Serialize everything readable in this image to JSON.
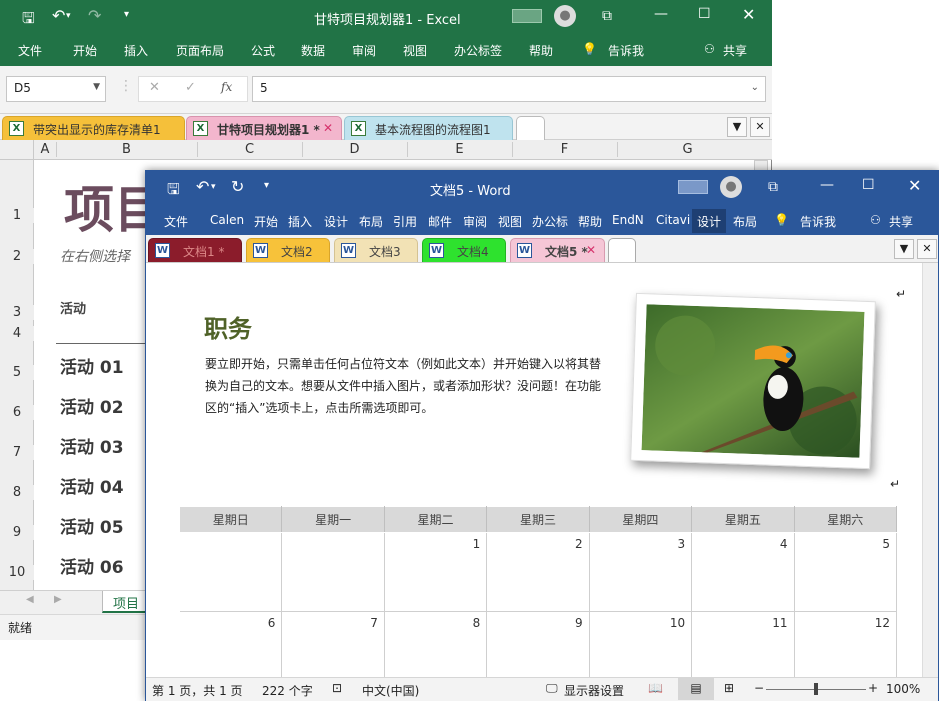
{
  "excel": {
    "title": "甘特项目规划器1  -  Excel",
    "menu": [
      "文件",
      "开始",
      "插入",
      "页面布局",
      "公式",
      "数据",
      "审阅",
      "视图",
      "办公标签",
      "帮助"
    ],
    "tell_me": "告诉我",
    "share": "共享",
    "name_box": "D5",
    "formula_value": "5",
    "fx_label": "fx",
    "doc_tabs": [
      {
        "label": "带突出显示的库存清单1",
        "color": "#f5c03a",
        "active": false
      },
      {
        "label": "甘特项目规划器1 *",
        "color": "#f3b6cd",
        "active": true
      },
      {
        "label": "基本流程图的流程图1",
        "color": "#bfe3ee",
        "active": false
      }
    ],
    "columns": [
      "A",
      "B",
      "C",
      "D",
      "E",
      "F",
      "G"
    ],
    "rows": [
      "1",
      "2",
      "3",
      "4",
      "5",
      "6",
      "7",
      "8",
      "9",
      "10"
    ],
    "sheet_title": "项目",
    "hint": "在右侧选择",
    "activity_header": "活动",
    "activities": [
      "活动 01",
      "活动 02",
      "活动 03",
      "活动 04",
      "活动 05",
      "活动 06"
    ],
    "sheet_tab": "项目规",
    "status": "就绪"
  },
  "word": {
    "title": "文档5  -  Word",
    "menu": [
      "文件",
      "Calen",
      "开始",
      "插入",
      "设计",
      "布局",
      "引用",
      "邮件",
      "审阅",
      "视图",
      "办公标",
      "帮助",
      "EndN",
      "Citavi",
      "设计",
      "布局"
    ],
    "tell_me": "告诉我",
    "share": "共享",
    "doc_tabs": [
      {
        "label": "文档1 *",
        "color": "#8b1c2b",
        "text_color": "#d88",
        "active": false
      },
      {
        "label": "文档2",
        "color": "#f7c23a",
        "text_color": "#333",
        "active": false
      },
      {
        "label": "文档3",
        "color": "#f2e2b5",
        "text_color": "#333",
        "active": false
      },
      {
        "label": "文档4",
        "color": "#2ee22e",
        "text_color": "#333",
        "active": false
      },
      {
        "label": "文档5 *",
        "color": "#f5c6d6",
        "text_color": "#333",
        "active": true
      }
    ],
    "heading": "职务",
    "body": "要立即开始，只需单击任何占位符文本（例如此文本）并开始键入以将其替换为自己的文本。想要从文件中插入图片，或者添加形状？没问题！在功能区的“插入”选项卡上，点击所需选项即可。",
    "weekdays": [
      "星期日",
      "星期一",
      "星期二",
      "星期三",
      "星期四",
      "星期五",
      "星期六"
    ],
    "week1": [
      "",
      "",
      "1",
      "2",
      "3",
      "4",
      "5"
    ],
    "week2": [
      "6",
      "7",
      "8",
      "9",
      "10",
      "11",
      "12"
    ],
    "para_mark": "↵",
    "status": {
      "page": "第 1 页，共 1 页",
      "words": "222 个字",
      "lang": "中文(中国)",
      "display": "显示器设置",
      "zoom": "100%"
    },
    "accent": "#2b579a"
  }
}
